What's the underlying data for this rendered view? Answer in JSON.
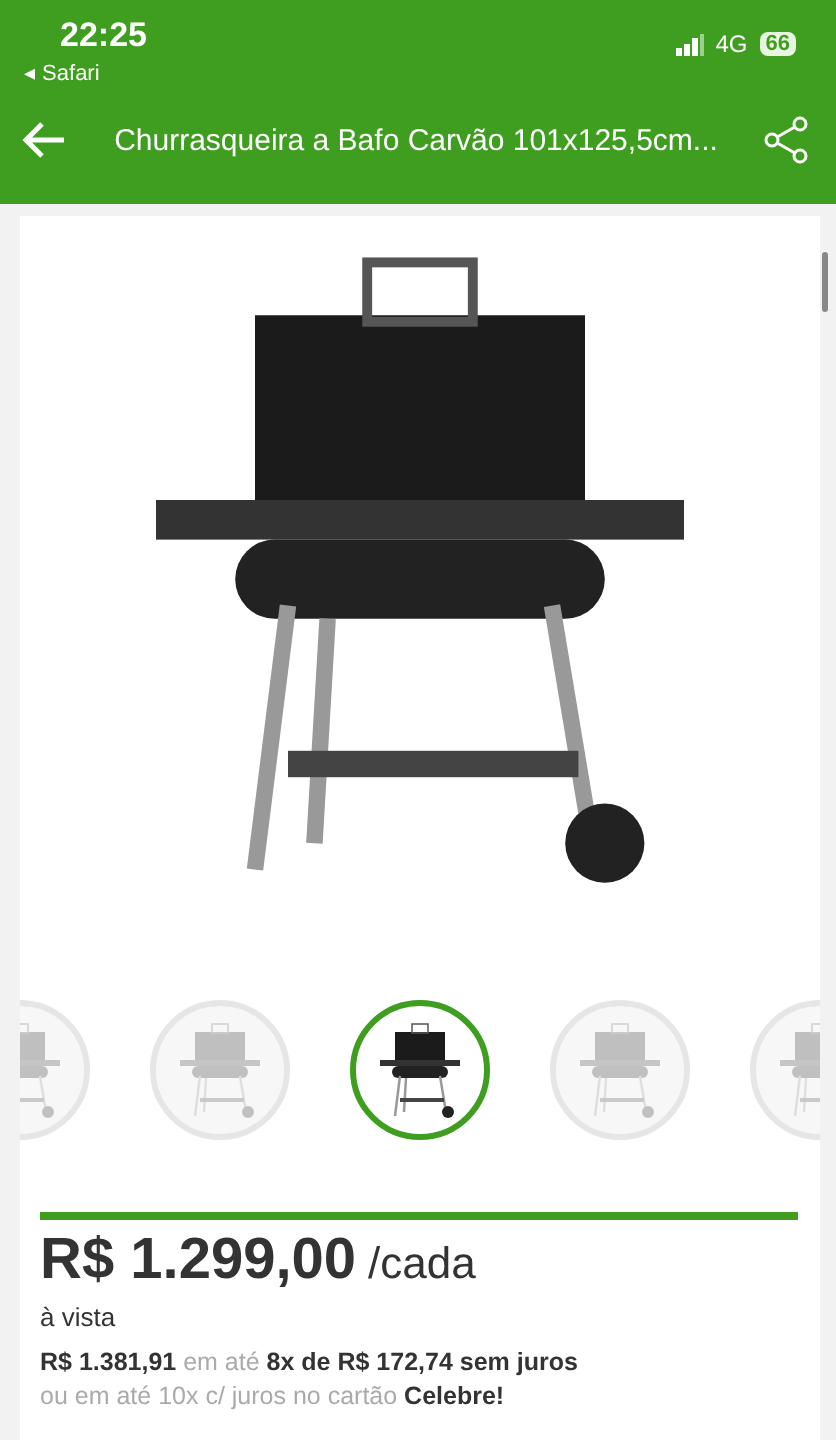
{
  "status_bar": {
    "time": "22:25",
    "back_app": "◂ Safari",
    "network": "4G",
    "battery": "66"
  },
  "header": {
    "title": "Churrasqueira a Bafo Carvão 101x125,5cm..."
  },
  "gallery": {
    "thumbnails": [
      {
        "selected": false
      },
      {
        "selected": false
      },
      {
        "selected": true
      },
      {
        "selected": false
      },
      {
        "selected": false
      }
    ]
  },
  "price": {
    "amount": "R$ 1.299,00",
    "unit": "/cada",
    "payment_note": "à vista",
    "installments": "**R$ 1.381,91** em até **8x de R$ 172,74 sem juros**",
    "card_offer": "ou em até 10x c/ juros no cartão **Celebre!**"
  }
}
